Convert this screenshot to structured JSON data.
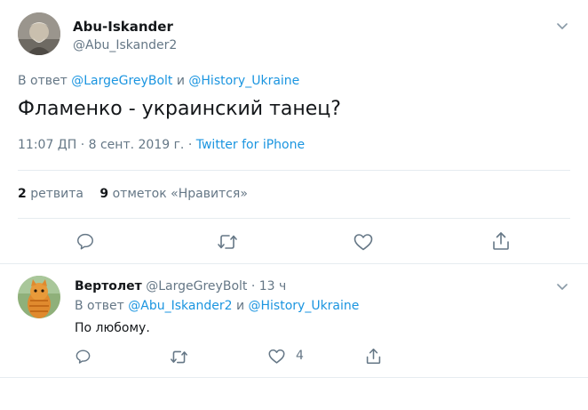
{
  "main_tweet": {
    "author_name": "Abu-Iskander",
    "author_handle": "@Abu_Iskander2",
    "reply_prefix": "В ответ",
    "reply_user1": "@LargeGreyBolt",
    "reply_conj": "и",
    "reply_user2": "@History_Ukraine",
    "text": "Фламенко - украинский танец?",
    "time": "11:07 ДП",
    "dot": "·",
    "date": "8 сент. 2019 г.",
    "source": "Twitter for iPhone",
    "retweets_count": "2",
    "retweets_label": "ретвита",
    "likes_count": "9",
    "likes_label": "отметок «Нравится»"
  },
  "reply_tweet": {
    "author_name": "Вертолет",
    "author_handle": "@LargeGreyBolt",
    "dot": "·",
    "time_ago": "13 ч",
    "reply_prefix": "В ответ",
    "reply_user1": "@Abu_Iskander2",
    "reply_conj": "и",
    "reply_user2": "@History_Ukraine",
    "text": "По любому.",
    "likes_count": "4"
  },
  "icons": {
    "caret": "chevron-down-icon",
    "reply": "reply-icon",
    "retweet": "retweet-icon",
    "like": "heart-icon",
    "share": "share-icon"
  },
  "colors": {
    "link": "#1b95e0",
    "muted": "#657786",
    "text": "#14171a",
    "divider": "#e6ecf0"
  }
}
